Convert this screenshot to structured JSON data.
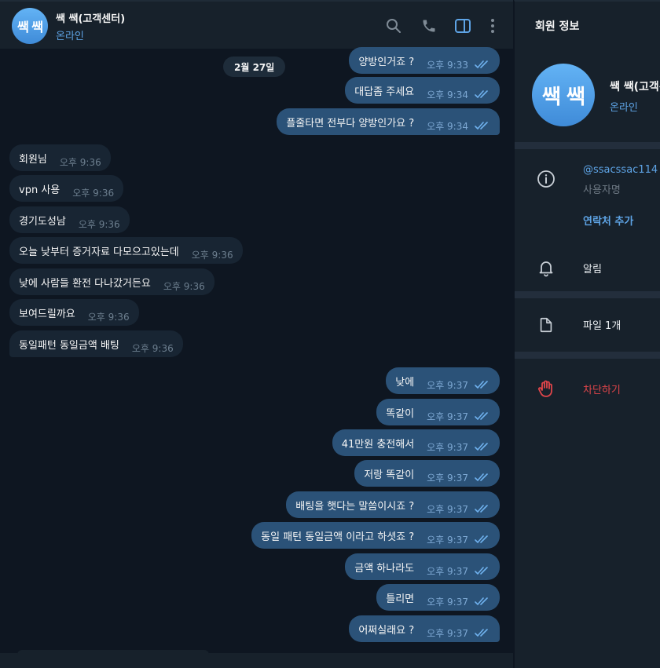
{
  "header": {
    "avatar_text": "쌕 쌕",
    "title": "쌕 쌕(고객센터)",
    "status": "온라인",
    "icons": [
      "search-icon",
      "phone-icon",
      "sidebar-toggle-icon",
      "more-vertical-icon"
    ]
  },
  "chat": {
    "date_label": "2월 27일",
    "messages": [
      {
        "dir": "out",
        "text": "양방인거죠 ?",
        "time": "오후 9:33",
        "read": true
      },
      {
        "dir": "out",
        "text": "대답좀 주세요",
        "time": "오후 9:34",
        "read": true
      },
      {
        "dir": "out",
        "text": "플줄타면 전부다 양방인가요 ?",
        "time": "오후 9:34",
        "read": true
      },
      {
        "dir": "in",
        "text": "회원님",
        "time": "오후 9:36"
      },
      {
        "dir": "in",
        "text": "vpn 사용",
        "time": "오후 9:36"
      },
      {
        "dir": "in",
        "text": "경기도성남",
        "time": "오후 9:36"
      },
      {
        "dir": "in",
        "text": "오늘 낮부터 증거자료 다모으고있는데",
        "time": "오후 9:36"
      },
      {
        "dir": "in",
        "text": "낮에 사람들 환전 다나갔거든요",
        "time": "오후 9:36"
      },
      {
        "dir": "in",
        "text": "보여드릴까요",
        "time": "오후 9:36"
      },
      {
        "dir": "in",
        "text": "동일패턴 동일금액 배팅",
        "time": "오후 9:36"
      },
      {
        "dir": "out",
        "text": "낮에",
        "time": "오후 9:37",
        "read": true
      },
      {
        "dir": "out",
        "text": "똑같이",
        "time": "오후 9:37",
        "read": true
      },
      {
        "dir": "out",
        "text": "41만원 충전해서",
        "time": "오후 9:37",
        "read": true
      },
      {
        "dir": "out",
        "text": "저랑 똑같이",
        "time": "오후 9:37",
        "read": true
      },
      {
        "dir": "out",
        "text": "배팅을 햇다는 말씀이시죠 ?",
        "time": "오후 9:37",
        "read": true
      },
      {
        "dir": "out",
        "text": "동일 패턴 동일금액 이라고 하셧죠 ?",
        "time": "오후 9:37",
        "read": true
      },
      {
        "dir": "out",
        "text": "금액 하나라도",
        "time": "오후 9:37",
        "read": true
      },
      {
        "dir": "out",
        "text": "틀리면",
        "time": "오후 9:37",
        "read": true
      },
      {
        "dir": "out",
        "text": "어쩌실래요 ?",
        "time": "오후 9:37",
        "read": true
      }
    ]
  },
  "panel": {
    "title": "회원 정보",
    "avatar_text": "쌕 쌕",
    "name": "쌕 쌕(고객센터)",
    "status": "온라인",
    "username": "@ssacssac114",
    "username_label": "사용자명",
    "add_contact": "연락처 추가",
    "notifications": "알림",
    "files": "파일 1개",
    "block": "차단하기"
  },
  "colors": {
    "accent": "#5ea4e6",
    "outgoing_bubble": "#2b5278",
    "incoming_bubble": "#182533",
    "danger": "#e0454a"
  }
}
